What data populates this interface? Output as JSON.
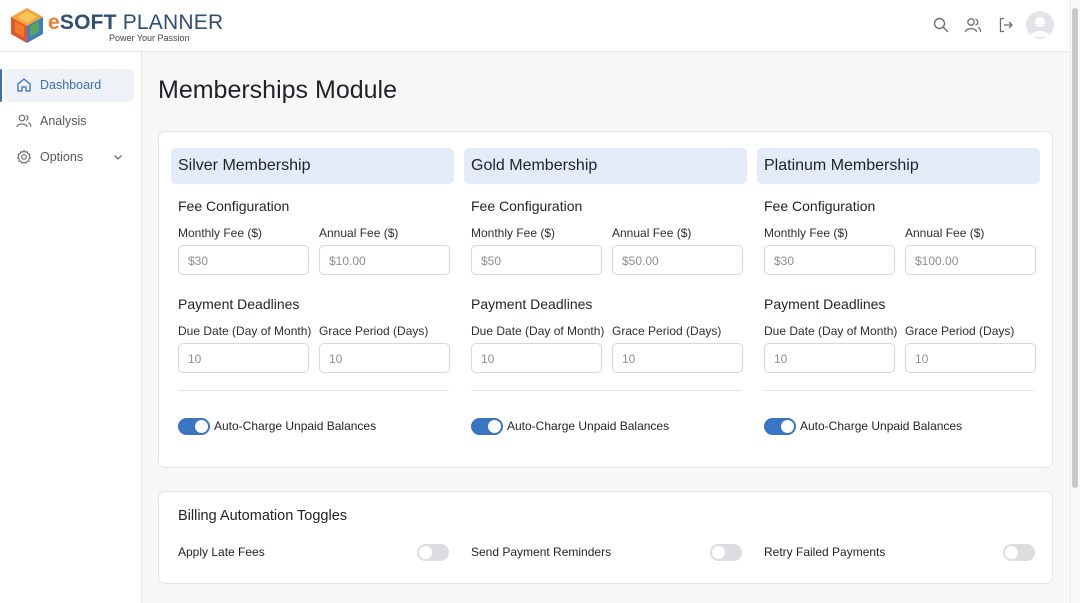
{
  "brand": {
    "name_e": "e",
    "name_soft": "SOFT",
    "name_planner": " PLANNER",
    "tagline": "Power Your Passion",
    "colors": {
      "orange": "#f07b2a",
      "navy": "#2f4f74"
    }
  },
  "header_icons": [
    "search-icon",
    "users-icon",
    "logout-icon",
    "avatar"
  ],
  "sidebar": {
    "items": [
      {
        "label": "Dashboard",
        "icon": "home-icon",
        "active": true
      },
      {
        "label": "Analysis",
        "icon": "users-icon",
        "active": false
      },
      {
        "label": "Options",
        "icon": "gear-icon",
        "active": false
      }
    ]
  },
  "page": {
    "title": "Memberships Module"
  },
  "common": {
    "fee_section": "Fee Configuration",
    "monthly_label": "Monthly Fee ($)",
    "annual_label": "Annual Fee ($)",
    "deadline_section": "Payment Deadlines",
    "due_label": "Due Date (Day of Month)",
    "grace_label": "Grace Period (Days)",
    "auto_charge_label": "Auto-Charge Unpaid Balances"
  },
  "memberships": [
    {
      "title": "Silver Membership",
      "monthly_placeholder": "$30",
      "annual_placeholder": "$10.00",
      "due_placeholder": "10",
      "grace_placeholder": "10",
      "auto_charge": true
    },
    {
      "title": "Gold Membership",
      "monthly_placeholder": "$50",
      "annual_placeholder": "$50.00",
      "due_placeholder": "10",
      "grace_placeholder": "10",
      "auto_charge": true
    },
    {
      "title": "Platinum Membership",
      "monthly_placeholder": "$30",
      "annual_placeholder": "$100.00",
      "due_placeholder": "10",
      "grace_placeholder": "10",
      "auto_charge": true
    }
  ],
  "billing": {
    "title": "Billing Automation Toggles",
    "toggles": [
      {
        "label": "Apply Late Fees",
        "on": false
      },
      {
        "label": "Send Payment Reminders",
        "on": false
      },
      {
        "label": "Retry Failed Payments",
        "on": false
      }
    ]
  },
  "colors": {
    "accent": "#3b74c2",
    "header_bg": "#e2ebf7",
    "toggle_off": "#dcdde0"
  }
}
